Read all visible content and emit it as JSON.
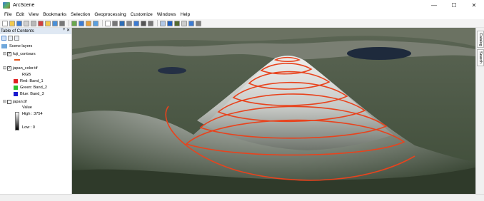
{
  "window": {
    "title": "ArcScene",
    "minimize": "—",
    "maximize": "☐",
    "close": "✕"
  },
  "menu": [
    "File",
    "Edit",
    "View",
    "Bookmarks",
    "Selection",
    "Geoprocessing",
    "Customize",
    "Windows",
    "Help"
  ],
  "toc": {
    "title": "Table of Contents",
    "pin": "ᵠ",
    "close": "✕",
    "scene_layers": "Scene layers",
    "layers": {
      "fuji": {
        "name": "fuji_contours",
        "checked": "✓",
        "expander": "⊟"
      },
      "japan_color": {
        "name": "japan_color.tif",
        "checked": "✓",
        "expander": "⊟",
        "renderer": "RGB",
        "bands": [
          {
            "label": "Red:   Band_1",
            "color": "#e02020"
          },
          {
            "label": "Green: Band_2",
            "color": "#2ec02e"
          },
          {
            "label": "Blue:  Band_3",
            "color": "#1a1ad0"
          }
        ]
      },
      "japan": {
        "name": "japan.tif",
        "checked": "",
        "expander": "⊟",
        "legend_title": "Value",
        "high": "High : 3754",
        "low": "Low : 0"
      }
    }
  },
  "dock": {
    "catalog": "Catalog",
    "search": "Search"
  },
  "toolbar_icon_colors": [
    "#ffffff",
    "#f2c94c",
    "#3b7bd4",
    "#cfcfcf",
    "#b8b8b8",
    "#d04040",
    "#f2c94c",
    "#4a90d9",
    "#777777",
    "#6aa84f",
    "#3b7bd4",
    "#e8a13c",
    "#5aa0e0",
    "#ffffff",
    "#777777",
    "#2d6db5",
    "#888888",
    "#3b7bd4",
    "#555555",
    "#777777",
    "#b0c7e6",
    "#1f5fbf",
    "#556b2f",
    "#cccccc",
    "#3b7bd4",
    "#7f7f7f"
  ]
}
